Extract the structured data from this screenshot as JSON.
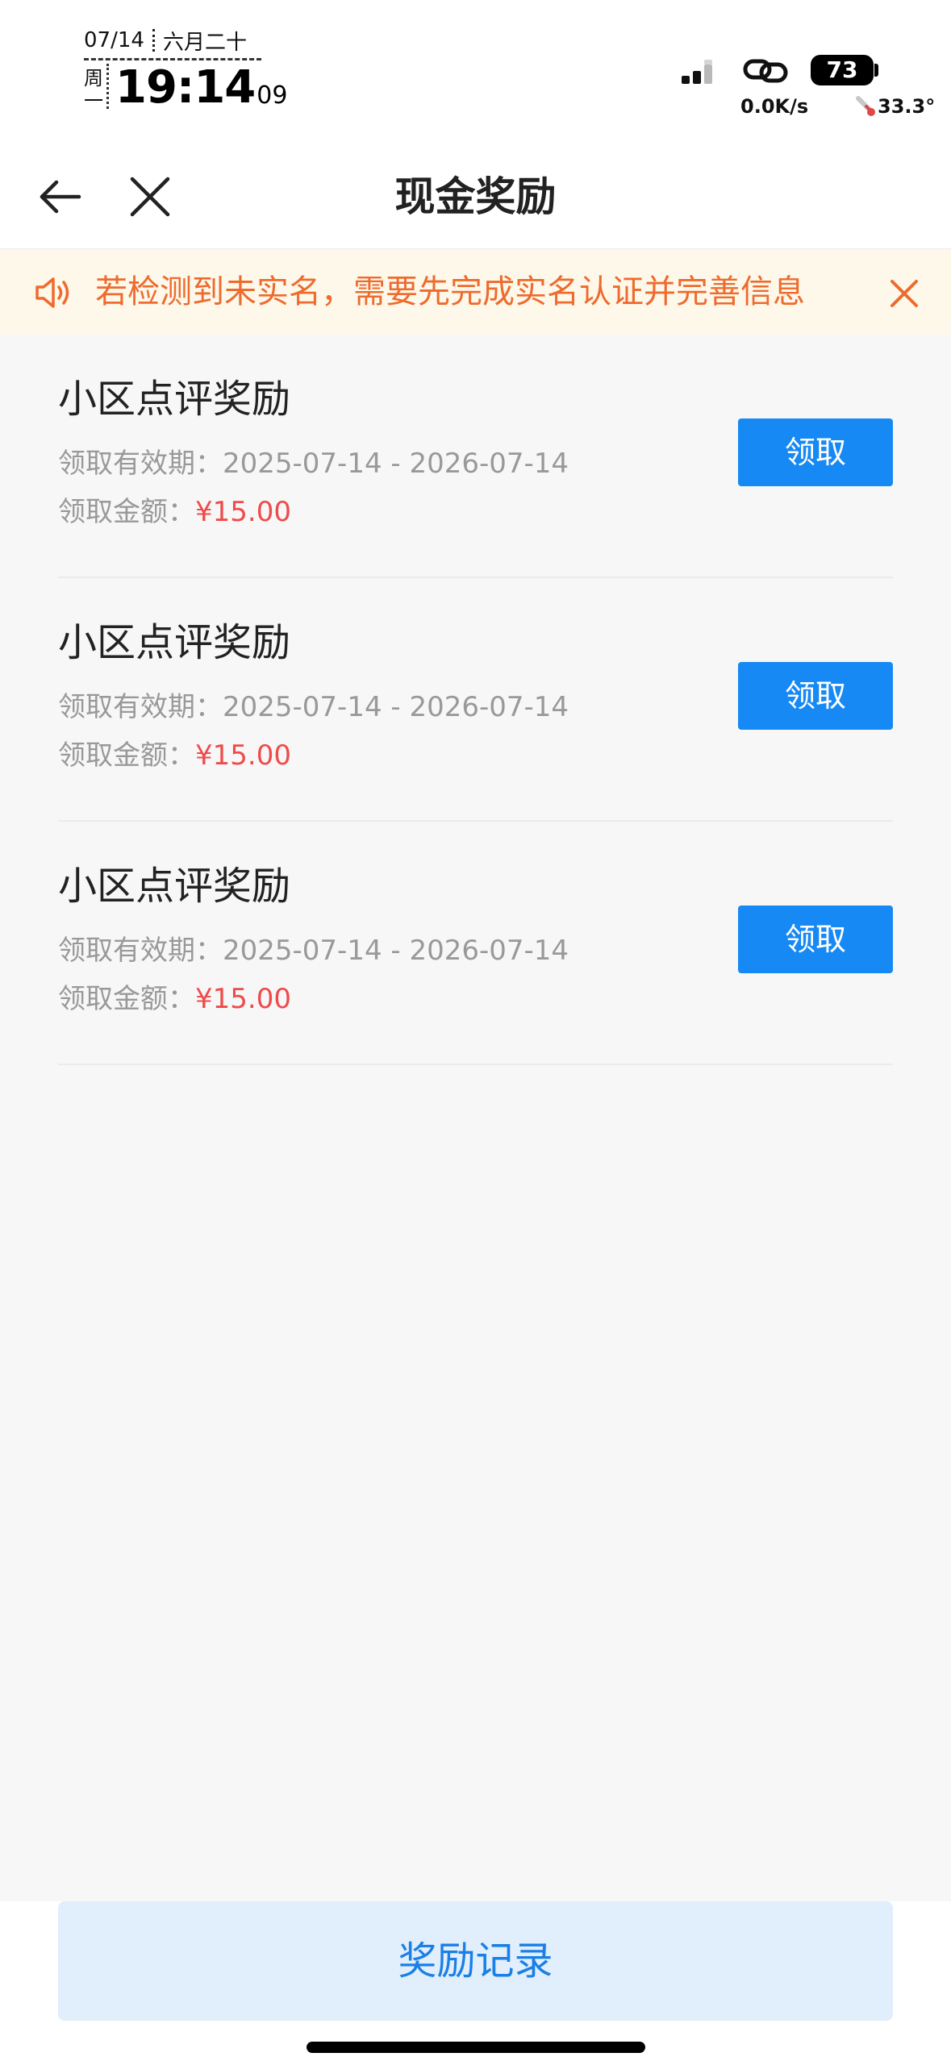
{
  "status_bar": {
    "date": "07/14",
    "lunar": "六月二十",
    "weekday_top": "周",
    "weekday_bottom": "一",
    "time": "19:14",
    "seconds": "09",
    "battery": "73",
    "net_speed": "0.0K/s",
    "temperature": "33.3°"
  },
  "nav": {
    "title": "现金奖励",
    "back_icon": "arrow-left-icon",
    "close_icon": "close-icon"
  },
  "notice": {
    "text": "若检测到未实名，需要先完成实名认证并完善信息",
    "icon": "speaker-icon",
    "close_icon": "close-icon",
    "color": "#ee6b2d"
  },
  "rewards": [
    {
      "title": "小区点评奖励",
      "period_label": "领取有效期：",
      "period": "2025-07-14 - 2026-07-14",
      "amount_label": "领取金额：",
      "amount": "¥15.00",
      "button": "领取"
    },
    {
      "title": "小区点评奖励",
      "period_label": "领取有效期：",
      "period": "2025-07-14 - 2026-07-14",
      "amount_label": "领取金额：",
      "amount": "¥15.00",
      "button": "领取"
    },
    {
      "title": "小区点评奖励",
      "period_label": "领取有效期：",
      "period": "2025-07-14 - 2026-07-14",
      "amount_label": "领取金额：",
      "amount": "¥15.00",
      "button": "领取"
    }
  ],
  "footer": {
    "records_button": "奖励记录"
  },
  "colors": {
    "accent": "#1689f4",
    "amount": "#ef4b4b",
    "notice_bg": "#fdf8ea"
  }
}
